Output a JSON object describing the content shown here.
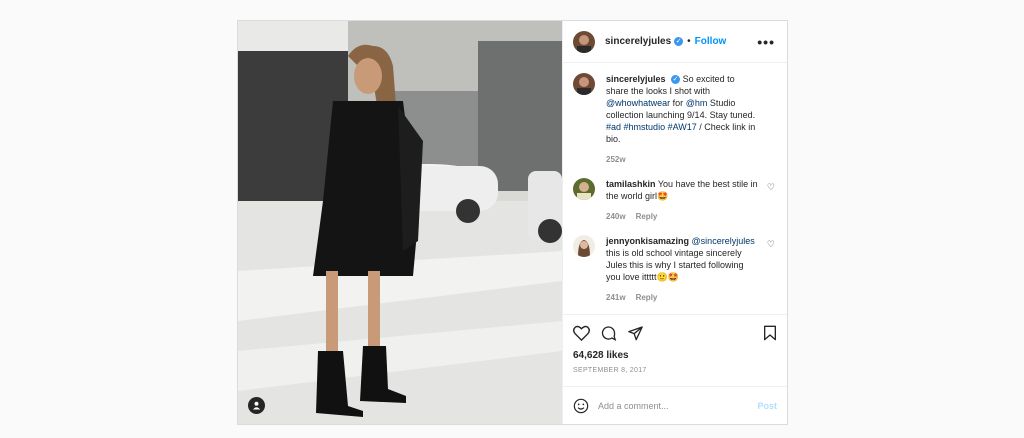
{
  "post": {
    "username": "sincerelyjules",
    "follow_label": "Follow",
    "separator": "•",
    "more_label": "•••",
    "caption_user": "sincerelyjules",
    "caption_parts": [
      "So excited to share the looks I shot with ",
      "@whowhatwear",
      " for ",
      "@hm",
      " Studio collection launching 9/14. Stay tuned. ",
      "#ad",
      " ",
      "#hmstudio",
      " ",
      "#AW17",
      " / Check link in bio."
    ],
    "caption_age": "252w",
    "comments": [
      {
        "user": "tamilashkin",
        "text_parts": [
          "You have the best stile in the world girl🤩"
        ],
        "age": "240w",
        "reply": "Reply"
      },
      {
        "user": "jennyonkisamazing",
        "text_parts": [
          "@sincerelyjules",
          " this is old school vintage sincerely Jules this is why I started following you love ittttt🙂🤩"
        ],
        "age": "241w",
        "reply": "Reply"
      }
    ],
    "likes": "64,628 likes",
    "date": "SEPTEMBER 8, 2017",
    "comment_placeholder": "Add a comment...",
    "post_label": "Post"
  },
  "colors": {
    "link": "#0095f6",
    "mention": "#00376b",
    "muted": "#8e8e8e",
    "post_disabled": "#b2dffc"
  },
  "icons": [
    "heart-icon",
    "comment-icon",
    "share-icon",
    "bookmark-icon",
    "emoji-icon",
    "user-tag-icon",
    "verified-icon",
    "more-icon"
  ]
}
